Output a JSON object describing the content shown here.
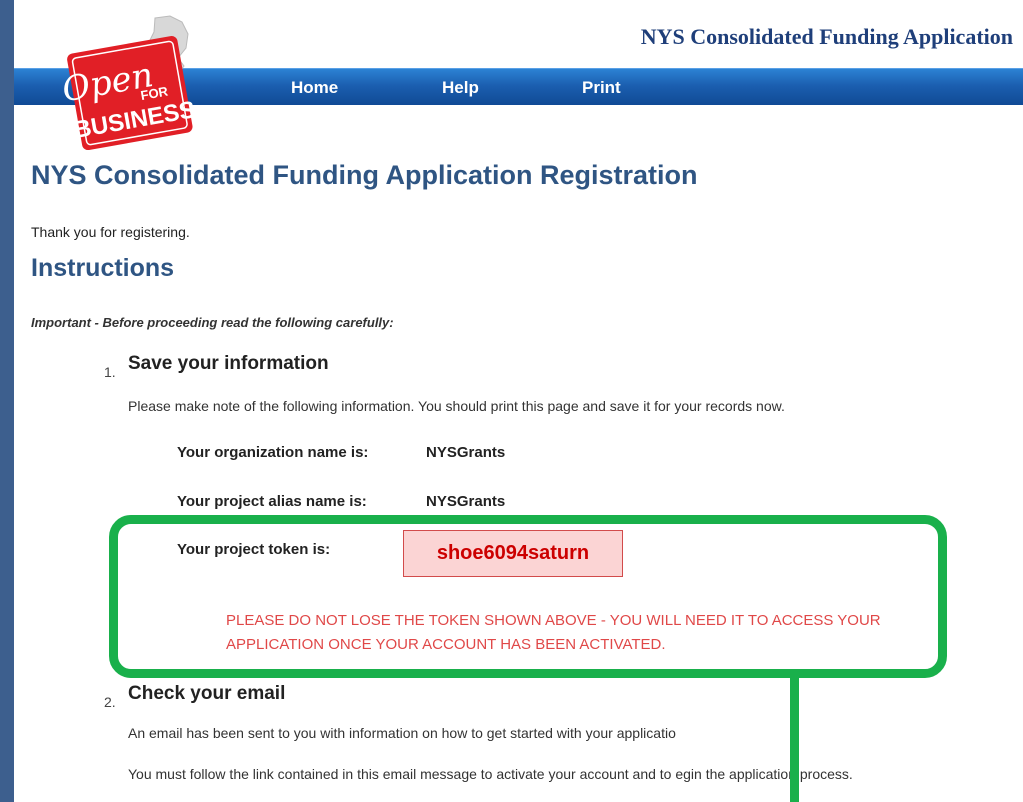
{
  "header": {
    "site_title": "NYS Consolidated Funding Application",
    "logo_text": [
      "Open",
      "FOR",
      "BUSINESS"
    ]
  },
  "nav": [
    {
      "label": "Home"
    },
    {
      "label": "Help"
    },
    {
      "label": "Print"
    }
  ],
  "main": {
    "page_title": "NYS Consolidated Funding Application Registration",
    "thanks": "Thank you for registering.",
    "instructions_title": "Instructions",
    "important": "Important - Before proceeding read the following carefully:",
    "steps": [
      {
        "number": "1.",
        "title": "Save your information",
        "text": "Please make note of the following information. You should print this page and save it for your records now.",
        "info": [
          {
            "label": "Your organization name is:",
            "value": "NYSGrants"
          },
          {
            "label": "Your project alias name is:",
            "value": "NYSGrants"
          },
          {
            "label": "Your project token is:",
            "value": "shoe6094saturn"
          }
        ],
        "warning": "PLEASE DO NOT LOSE THE TOKEN SHOWN ABOVE - YOU WILL NEED IT TO ACCESS YOUR APPLICATION ONCE YOUR ACCOUNT HAS BEEN ACTIVATED."
      },
      {
        "number": "2.",
        "title": "Check your email",
        "text1": "An email has been sent to you with information on how to get started with your applicatio",
        "text2": "You must follow the link contained in this email message to activate your account and to  egin the application process."
      }
    ]
  },
  "colors": {
    "highlight": "#19b04b",
    "title_blue": "#2f5583",
    "token_red": "#cc0000"
  }
}
